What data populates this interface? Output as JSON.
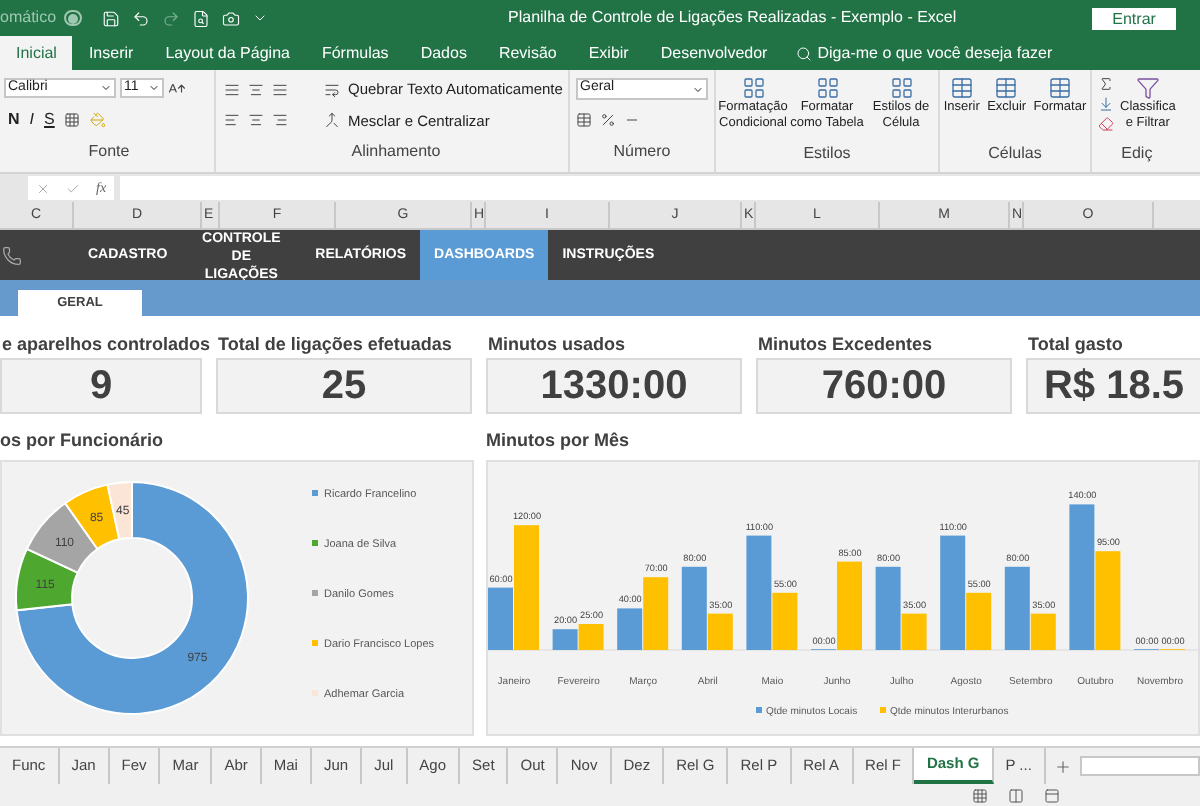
{
  "title_bar": {
    "autosave_label": "omático",
    "autosave_on": false,
    "title": "Planilha de Controle de Ligações Realizadas - Exemplo  -  Excel",
    "sign_in": "Entrar"
  },
  "ribbon_tabs": [
    {
      "label": "Inicial",
      "selected": true
    },
    {
      "label": "Inserir",
      "selected": false
    },
    {
      "label": "Layout da Página",
      "selected": false
    },
    {
      "label": "Fórmulas",
      "selected": false
    },
    {
      "label": "Dados",
      "selected": false
    },
    {
      "label": "Revisão",
      "selected": false
    },
    {
      "label": "Exibir",
      "selected": false
    },
    {
      "label": "Desenvolvedor",
      "selected": false
    }
  ],
  "tell_me": {
    "placeholder": "Diga-me o que você deseja fazer"
  },
  "ribbon": {
    "font": {
      "name": "Calibri",
      "size": "11",
      "bold": "N",
      "italic": "I",
      "underline": "S",
      "label": "Fonte"
    },
    "alignment": {
      "wrap_text": "Quebrar Texto Automaticamente",
      "merge": "Mesclar e Centralizar",
      "label": "Alinhamento"
    },
    "number": {
      "format": "Geral",
      "label": "Número"
    },
    "styles": {
      "buttons": [
        "Formatação Condicional",
        "Formatar como Tabela",
        "Estilos de Célula"
      ],
      "label": "Estilos"
    },
    "cells": {
      "buttons": [
        "Inserir",
        "Excluir",
        "Formatar"
      ],
      "label": "Células"
    },
    "editing": {
      "sort_filter": [
        "Classifica",
        "e Filtrar"
      ],
      "label": "Ediç"
    }
  },
  "formula_bar": {
    "fx": "fx"
  },
  "columns": [
    "C",
    "D",
    "E",
    "F",
    "G",
    "H",
    "I",
    "J",
    "K",
    "L",
    "M",
    "N",
    "O"
  ],
  "nav_tabs": [
    {
      "label": "CADASTRO",
      "selected": false
    },
    {
      "label": "CONTROLE DE LIGAÇÕES",
      "selected": false
    },
    {
      "label": "RELATÓRIOS",
      "selected": false
    },
    {
      "label": "DASHBOARDS",
      "selected": true
    },
    {
      "label": "INSTRUÇÕES",
      "selected": false
    }
  ],
  "sub_tabs": [
    {
      "label": "GERAL",
      "selected": true
    }
  ],
  "kpis": [
    {
      "label": "e aparelhos controlados",
      "value": "9"
    },
    {
      "label": "Total de ligações efetuadas",
      "value": "25"
    },
    {
      "label": "Minutos usados",
      "value": "1330:00"
    },
    {
      "label": "Minutos Excedentes",
      "value": "760:00"
    },
    {
      "label": "Total gasto",
      "value": "R$ 18.5"
    }
  ],
  "donut": {
    "title": "os por Funcionário",
    "chart_data": {
      "type": "donut",
      "categories": [
        "Ricardo Francelino",
        "Joana de Silva",
        "Danilo Gomes",
        "Dario Francisco Lopes",
        "Adhemar Garcia"
      ],
      "colors": [
        "#5b9bd5",
        "#4ea72e",
        "#a5a5a5",
        "#ffc000",
        "#fbe5d6"
      ],
      "values": [
        975,
        115,
        110,
        85,
        45
      ],
      "data_labels": true,
      "legend": true
    }
  },
  "bar_chart": {
    "title": "Minutos por Mês",
    "chart_data": {
      "type": "bar",
      "categories": [
        "Janeiro",
        "Fevereiro",
        "Março",
        "Abril",
        "Maio",
        "Junho",
        "Julho",
        "Agosto",
        "Setembro",
        "Outubro",
        "Novembro"
      ],
      "data_labels": true,
      "legend": true,
      "series": [
        {
          "name": "Qtde minutos Locais",
          "color": "#5b9bd5",
          "values": [
            60,
            20,
            40,
            80,
            110,
            0,
            80,
            110,
            80,
            140,
            0
          ],
          "value_labels": [
            "60:00",
            "20:00",
            "40:00",
            "80:00",
            "110:00",
            "00:00",
            "80:00",
            "110:00",
            "80:00",
            "140:00",
            "00:00"
          ]
        },
        {
          "name": "Qtde minutos Interurbanos",
          "color": "#ffc000",
          "values": [
            120,
            25,
            70,
            35,
            55,
            85,
            35,
            55,
            35,
            95,
            0
          ],
          "value_labels": [
            "120:00",
            "25:00",
            "70:00",
            "35:00",
            "55:00",
            "85:00",
            "35:00",
            "55:00",
            "35:00",
            "95:00",
            "00:00"
          ]
        }
      ]
    }
  },
  "sheet_tabs": [
    {
      "label": "Func",
      "selected": false
    },
    {
      "label": "Jan",
      "selected": false
    },
    {
      "label": "Fev",
      "selected": false
    },
    {
      "label": "Mar",
      "selected": false
    },
    {
      "label": "Abr",
      "selected": false
    },
    {
      "label": "Mai",
      "selected": false
    },
    {
      "label": "Jun",
      "selected": false
    },
    {
      "label": "Jul",
      "selected": false
    },
    {
      "label": "Ago",
      "selected": false
    },
    {
      "label": "Set",
      "selected": false
    },
    {
      "label": "Out",
      "selected": false
    },
    {
      "label": "Nov",
      "selected": false
    },
    {
      "label": "Dez",
      "selected": false
    },
    {
      "label": "Rel G",
      "selected": false
    },
    {
      "label": "Rel P",
      "selected": false
    },
    {
      "label": "Rel A",
      "selected": false
    },
    {
      "label": "Rel F",
      "selected": false
    },
    {
      "label": "Dash G",
      "selected": true
    },
    {
      "label": "P ...",
      "selected": false
    }
  ]
}
